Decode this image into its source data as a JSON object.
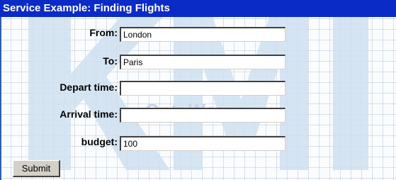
{
  "window": {
    "title": "Service Example: Finding Flights"
  },
  "watermark": {
    "text": "OntoWeaver"
  },
  "form": {
    "from": {
      "label": "From:",
      "value": "London"
    },
    "to": {
      "label": "To:",
      "value": "Paris"
    },
    "depart_time": {
      "label": "Depart time:",
      "value": ""
    },
    "arrival_time": {
      "label": "Arrival time:",
      "value": ""
    },
    "budget": {
      "label": "budget:",
      "value": "100"
    },
    "submit_label": "Submit"
  },
  "colors": {
    "titlebar": "#0b2bc7",
    "grid": "#aabed6",
    "watermark": "#c3d6ea",
    "button_face": "#d4d0c8"
  }
}
